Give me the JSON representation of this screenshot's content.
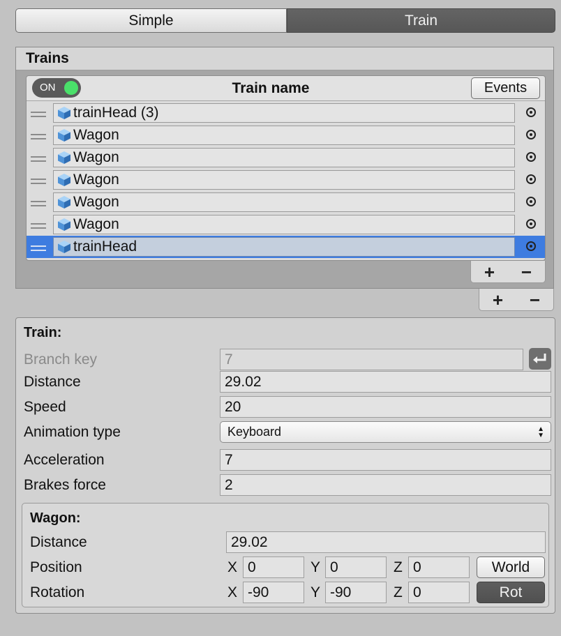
{
  "mode_toolbar": {
    "simple_label": "Simple",
    "train_label": "Train",
    "active": "Train"
  },
  "trains_list": {
    "header": "Trains",
    "toggle_label": "ON",
    "column_title": "Train name",
    "events_label": "Events",
    "rows": [
      {
        "name": "trainHead (3)",
        "selected": false
      },
      {
        "name": "Wagon",
        "selected": false
      },
      {
        "name": "Wagon",
        "selected": false
      },
      {
        "name": "Wagon",
        "selected": false
      },
      {
        "name": "Wagon",
        "selected": false
      },
      {
        "name": "Wagon",
        "selected": false
      },
      {
        "name": "trainHead",
        "selected": true
      }
    ],
    "add_symbol": "+",
    "remove_symbol": "−"
  },
  "train": {
    "title": "Train:",
    "branch_key_label": "Branch key",
    "branch_key_value": "7",
    "distance_label": "Distance",
    "distance_value": "29.02",
    "speed_label": "Speed",
    "speed_value": "20",
    "animation_type_label": "Animation type",
    "animation_type_value": "Keyboard",
    "acceleration_label": "Acceleration",
    "acceleration_value": "7",
    "brakes_force_label": "Brakes force",
    "brakes_force_value": "2"
  },
  "wagon": {
    "title": "Wagon:",
    "distance_label": "Distance",
    "distance_value": "29.02",
    "position_label": "Position",
    "position": {
      "x": "0",
      "y": "0",
      "z": "0"
    },
    "rotation_label": "Rotation",
    "rotation": {
      "x": "-90",
      "y": "-90",
      "z": "0"
    },
    "axis_x": "X",
    "axis_y": "Y",
    "axis_z": "Z",
    "world_label": "World",
    "rot_label": "Rot"
  },
  "colors": {
    "selection": "#3e7ce0",
    "toggle_on": "#4ae06a",
    "active_mode": "#5c5c5c"
  },
  "icons": {
    "row_icon": "cube-icon",
    "picker": "object-picker-icon",
    "return": "return-arrow-icon"
  }
}
